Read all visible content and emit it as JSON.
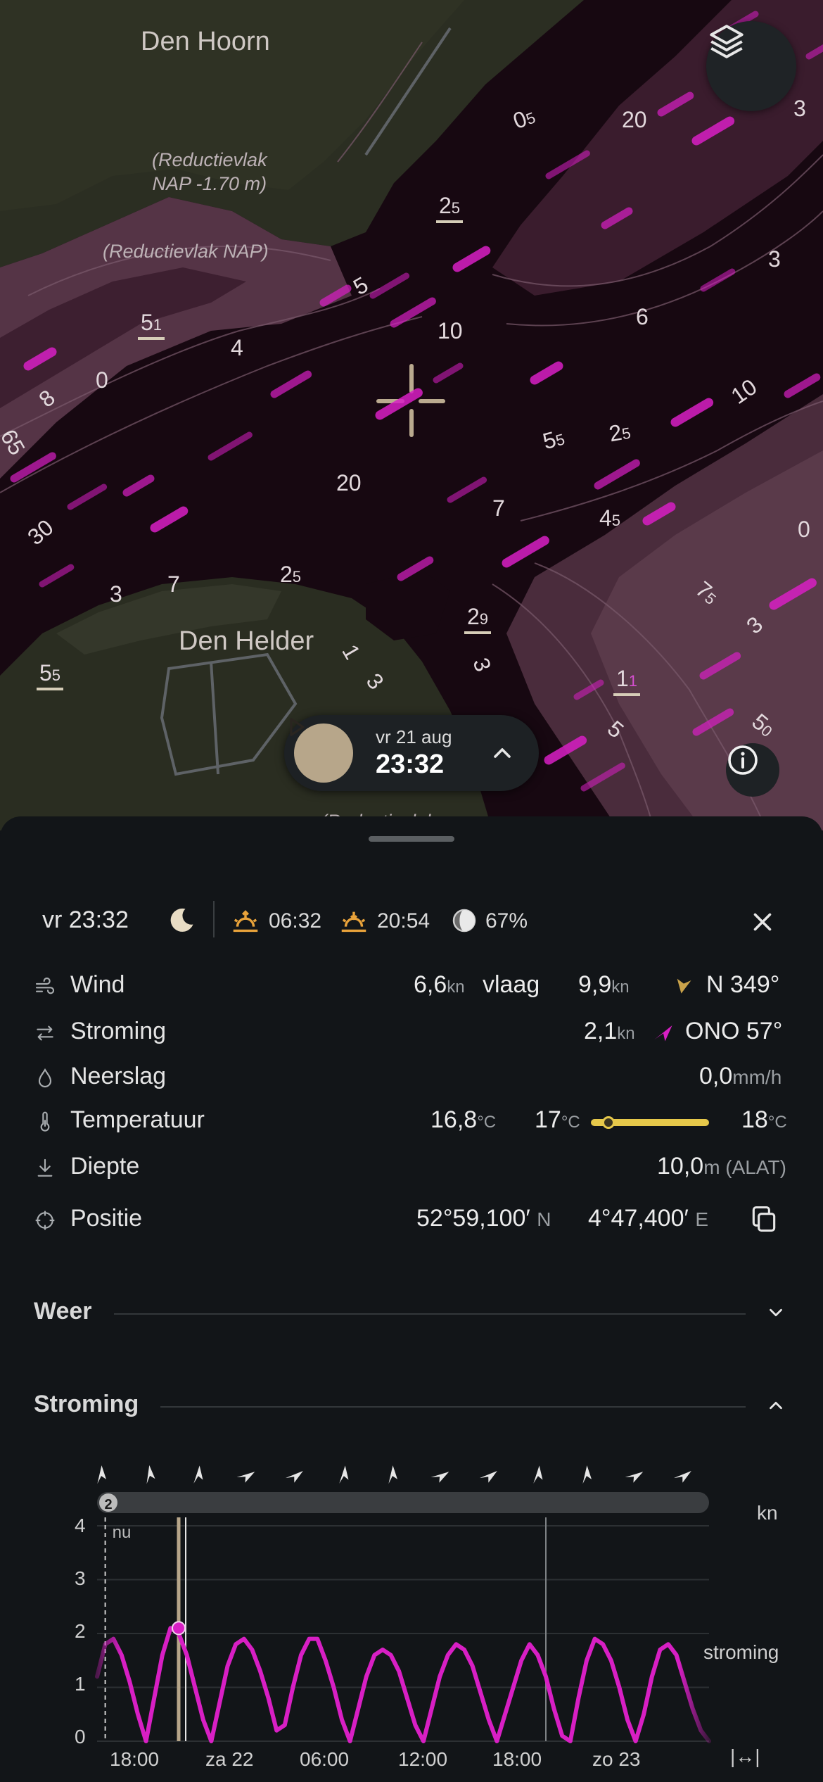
{
  "map": {
    "places": {
      "den_hoorn": "Den Hoorn",
      "den_helder": "Den Helder"
    },
    "notes": {
      "reductievlak_1": "(Reductievlak\nNAP -1.70 m)",
      "reductievlak_2": "(Reductievlak NAP)",
      "reductievlak_3": "(Reductievlak"
    },
    "depths": [
      "0",
      "5",
      "20",
      "3",
      "3",
      "2",
      "5",
      "1",
      "4",
      "10",
      "6",
      "8",
      "0",
      "65",
      "10",
      "5",
      "5",
      "2",
      "5",
      "20",
      "7",
      "4",
      "5",
      "0",
      "30",
      "3",
      "7",
      "2",
      "5",
      "2",
      "9",
      "7",
      "5",
      "3",
      "5",
      "5",
      "1",
      "3",
      "3",
      "1",
      "1",
      "5",
      "5",
      "0"
    ],
    "colors": {
      "water_deep": "#170811",
      "current_arrow": "#d81fc4",
      "land": "#2b2e22",
      "shallow": "#553446"
    }
  },
  "playbar": {
    "date": "vr 21 aug",
    "time": "23:32"
  },
  "summary": {
    "time": "vr 23:32",
    "sunrise": "06:32",
    "sunset": "20:54",
    "moon_phase": "67%",
    "icons": [
      "moon-icon",
      "sunrise-icon",
      "sunset-icon",
      "moon-phase-icon",
      "close-icon"
    ]
  },
  "rows": {
    "wind": {
      "label": "Wind",
      "speed": "6,6",
      "unit": "kn",
      "gust_label": "vlaag",
      "gust": "9,9",
      "gust_unit": "kn",
      "direction": "N 349°",
      "arrow_color": "#c9a24a"
    },
    "stroming": {
      "label": "Stroming",
      "speed": "2,1",
      "unit": "kn",
      "direction": "ONO 57°",
      "arrow_color": "#d81fc4"
    },
    "neerslag": {
      "label": "Neerslag",
      "value": "0,0",
      "unit": "mm/h"
    },
    "temperatuur": {
      "label": "Temperatuur",
      "value": "16,8",
      "unit": "°C",
      "min": "17",
      "min_unit": "°C",
      "max": "18",
      "max_unit": "°C",
      "bar_color": "#e6c84a",
      "position": 0.15
    },
    "diepte": {
      "label": "Diepte",
      "value": "10,0",
      "unit": "m (ALAT)"
    },
    "positie": {
      "label": "Positie",
      "lat": "52°59,100′",
      "lat_hem": "N",
      "lon": "4°47,400′",
      "lon_hem": "E"
    }
  },
  "sections": {
    "weer": {
      "title": "Weer",
      "expanded": false
    },
    "stroming": {
      "title": "Stroming",
      "expanded": true
    }
  },
  "chart_data": {
    "type": "line",
    "yunit": "kn",
    "series_label": "stroming",
    "now_label": "nu",
    "scrubber_badge": "2",
    "resize_label": "|↔|",
    "ylim": [
      0,
      4
    ],
    "yticks": [
      "4",
      "3",
      "2",
      "1",
      "0"
    ],
    "xticks": [
      "18:00",
      "za 22",
      "06:00",
      "12:00",
      "18:00",
      "zo 23"
    ],
    "line_color": "#d81fc4",
    "current_time_index": 22.5,
    "current_value": 2.1,
    "x_hours_from_18_00": [
      -1,
      0,
      1,
      2,
      3,
      4,
      5,
      6,
      7,
      8,
      9,
      10,
      11,
      12,
      13,
      14,
      15,
      16,
      17,
      18,
      19,
      20,
      21,
      22,
      23,
      24,
      25,
      26,
      27,
      28,
      29,
      30,
      31,
      32,
      33,
      34,
      35,
      36,
      37,
      38,
      39,
      40,
      41,
      42,
      43,
      44,
      45,
      46,
      47,
      48,
      49,
      50,
      51,
      52,
      53,
      54,
      55,
      56,
      57,
      58,
      59,
      60,
      61,
      62,
      63,
      64,
      65,
      66,
      67,
      68,
      69,
      70,
      71,
      72,
      73,
      74
    ],
    "values": [
      1.2,
      1.8,
      1.9,
      1.6,
      1.1,
      0.5,
      0.0,
      0.8,
      1.6,
      2.1,
      2.0,
      1.6,
      1.0,
      0.4,
      0.0,
      0.7,
      1.4,
      1.8,
      1.9,
      1.7,
      1.3,
      0.8,
      0.2,
      0.3,
      1.0,
      1.6,
      1.9,
      1.9,
      1.5,
      1.0,
      0.4,
      0.0,
      0.6,
      1.2,
      1.6,
      1.7,
      1.6,
      1.3,
      0.8,
      0.3,
      0.0,
      0.6,
      1.2,
      1.6,
      1.8,
      1.7,
      1.4,
      0.9,
      0.4,
      0.0,
      0.5,
      1.0,
      1.5,
      1.8,
      1.6,
      1.2,
      0.6,
      0.1,
      0.0,
      0.8,
      1.5,
      1.9,
      1.8,
      1.5,
      1.0,
      0.4,
      0.0,
      0.5,
      1.2,
      1.7,
      1.8,
      1.6,
      1.1,
      0.6,
      0.2,
      0.0
    ],
    "direction_arrows": 13
  }
}
